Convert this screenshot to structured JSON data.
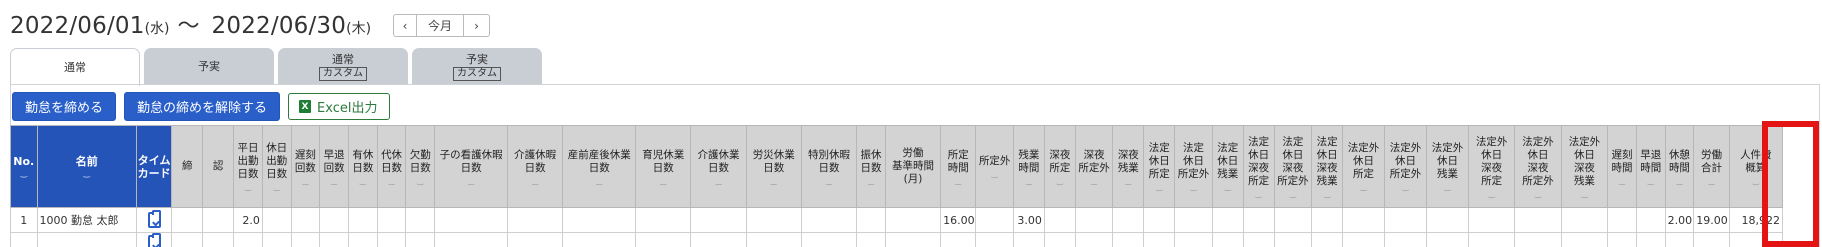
{
  "period": {
    "start_date": "2022/06/01",
    "start_dow": "(水)",
    "separator": "〜",
    "end_date": "2022/06/30",
    "end_dow": "(木)"
  },
  "nav": {
    "prev": "‹",
    "today": "今月",
    "next": "›"
  },
  "tabs": [
    {
      "label": "通常",
      "sub": ""
    },
    {
      "label": "予実",
      "sub": ""
    },
    {
      "label": "通常",
      "sub": "カスタム"
    },
    {
      "label": "予実",
      "sub": "カスタム"
    }
  ],
  "active_tab": 0,
  "toolbar": {
    "close_label": "勤怠を締める",
    "unclose_label": "勤怠の締めを解除する",
    "excel_label": "Excel出力",
    "excel_icon": "excel-icon"
  },
  "colors": {
    "header_blue": "#2454b8",
    "button_blue": "#2a5fc9",
    "excel_green": "#2c7a3c",
    "highlight_red": "#e41414"
  },
  "columns": [
    {
      "label": "No.",
      "style": "blue",
      "sortable": true
    },
    {
      "label": "名前",
      "style": "blue",
      "sortable": true
    },
    {
      "label": "タイム\nカード",
      "style": "blue",
      "sortable": false
    },
    {
      "label": "締",
      "sortable": false
    },
    {
      "label": "認",
      "sortable": false
    },
    {
      "label": "平日\n出勤\n日数",
      "sortable": true
    },
    {
      "label": "休日\n出勤\n日数",
      "sortable": true
    },
    {
      "label": "遅刻\n回数",
      "sortable": true
    },
    {
      "label": "早退\n回数",
      "sortable": true
    },
    {
      "label": "有休\n日数",
      "sortable": true
    },
    {
      "label": "代休\n日数",
      "sortable": true
    },
    {
      "label": "欠勤\n日数",
      "sortable": true
    },
    {
      "label": "子の看護休暇\n日数",
      "sortable": true
    },
    {
      "label": "介護休暇\n日数",
      "sortable": true
    },
    {
      "label": "産前産後休業\n日数",
      "sortable": true
    },
    {
      "label": "育児休業\n日数",
      "sortable": true
    },
    {
      "label": "介護休業\n日数",
      "sortable": true
    },
    {
      "label": "労災休業\n日数",
      "sortable": true
    },
    {
      "label": "特別休暇\n日数",
      "sortable": true
    },
    {
      "label": "振休\n日数",
      "sortable": true
    },
    {
      "label": "労働\n基準時間\n(月)",
      "sortable": false
    },
    {
      "label": "所定\n時間",
      "sortable": true
    },
    {
      "label": "所定外",
      "sortable": true
    },
    {
      "label": "残業\n時間",
      "sortable": true
    },
    {
      "label": "深夜\n所定",
      "sortable": true
    },
    {
      "label": "深夜\n所定外",
      "sortable": true
    },
    {
      "label": "深夜\n残業",
      "sortable": true
    },
    {
      "label": "法定\n休日\n所定",
      "sortable": true
    },
    {
      "label": "法定\n休日\n所定外",
      "sortable": true
    },
    {
      "label": "法定\n休日\n残業",
      "sortable": true
    },
    {
      "label": "法定\n休日\n深夜\n所定",
      "sortable": true
    },
    {
      "label": "法定\n休日\n深夜\n所定外",
      "sortable": true
    },
    {
      "label": "法定\n休日\n深夜\n残業",
      "sortable": true
    },
    {
      "label": "法定外\n休日\n所定",
      "sortable": true
    },
    {
      "label": "法定外\n休日\n所定外",
      "sortable": true
    },
    {
      "label": "法定外\n休日\n残業",
      "sortable": true
    },
    {
      "label": "法定外\n休日\n深夜\n所定",
      "sortable": true
    },
    {
      "label": "法定外\n休日\n深夜\n所定外",
      "sortable": true
    },
    {
      "label": "法定外\n休日\n深夜\n残業",
      "sortable": true
    },
    {
      "label": "遅刻\n時間",
      "sortable": true
    },
    {
      "label": "早退\n時間",
      "sortable": true
    },
    {
      "label": "休憩\n時間",
      "sortable": true
    },
    {
      "label": "労働\n合計",
      "sortable": true
    },
    {
      "label": "人件費\n概算",
      "sortable": true
    }
  ],
  "rows": [
    {
      "cells": [
        "1",
        "1000 勤怠 太郎",
        "",
        "",
        "",
        "2.0",
        "",
        "",
        "",
        "",
        "",
        "",
        "",
        "",
        "",
        "",
        "",
        "",
        "",
        "",
        "",
        "16.00",
        "",
        "3.00",
        "",
        "",
        "",
        "",
        "",
        "",
        "",
        "",
        "",
        "",
        "",
        "",
        "",
        "",
        "",
        "",
        "",
        "2.00",
        "19.00",
        "18,922"
      ],
      "timecard_icon": "clipboard-check-icon"
    }
  ],
  "highlighted_column": "人件費\n概算"
}
